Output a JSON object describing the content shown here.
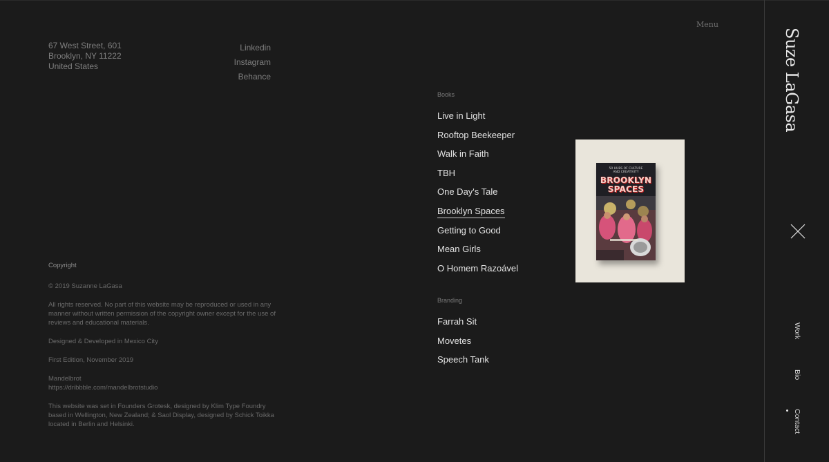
{
  "address": {
    "line1": "67 West Street, 601",
    "line2": "Brooklyn, NY 11222",
    "line3": "United States"
  },
  "social": [
    "Linkedin",
    "Instagram",
    "Behance"
  ],
  "menu_label": "Menu",
  "copyright": {
    "heading": "Copyright",
    "year_line": "© 2019 Suzanne LaGasa",
    "rights": "All rights reserved. No part of this website may be reproduced or used in any manner without written permission of the copyright owner except for the use of reviews and educational materials.",
    "designed": "Designed & Developed in Mexico City",
    "edition": "First Edition, November 2019",
    "studio_name": "Mandelbrot",
    "studio_url": "https://dribbble.com/mandelbrotstudio",
    "typefaces": "This website was set in Founders Grotesk, designed by Klim Type Foundry based in Wellington, New Zealand; & Saol Display, designed by Schick Toikka located in Berlin and Helsinki."
  },
  "books": {
    "label": "Books",
    "items": [
      "Live in Light",
      "Rooftop Beekeeper",
      "Walk in Faith",
      "TBH",
      "One Day's Tale",
      "Brooklyn Spaces",
      "Getting to Good",
      "Mean Girls",
      "O Homem Razoável"
    ],
    "active": "Brooklyn Spaces"
  },
  "branding": {
    "label": "Branding",
    "items": [
      "Farrah Sit",
      "Movetes",
      "Speech Tank"
    ]
  },
  "preview": {
    "subtitle_line1": "50 HUBS OF CULTURE",
    "subtitle_line2": "AND CREATIVITY",
    "title_line1": "BROOKLYN",
    "title_line2": "SPACES"
  },
  "sidebar": {
    "brand": "Suze LaGasa",
    "nav": [
      "Work",
      "Bio",
      "Contact"
    ],
    "active_nav": "Contact"
  },
  "colors": {
    "background": "#1b1b1b",
    "text_primary": "#e3e3e3",
    "text_muted": "#7f7f7f",
    "preview_bg": "#e9e5db"
  }
}
